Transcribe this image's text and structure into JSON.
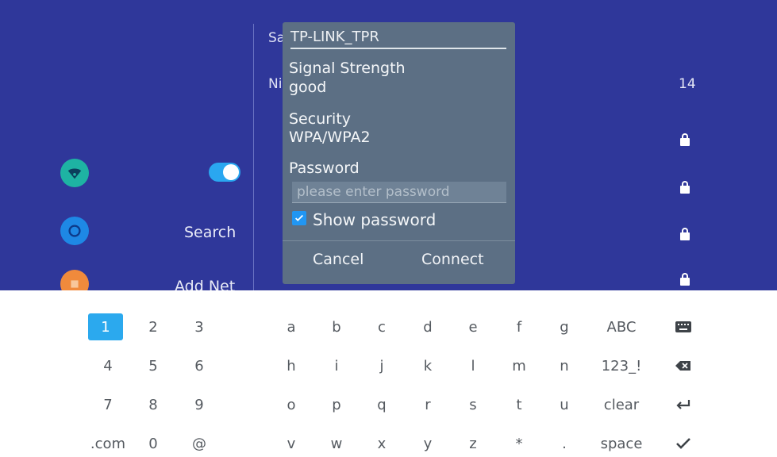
{
  "sidebar": {
    "search_label": "Search",
    "addnet_label": "Add Net"
  },
  "background": {
    "partial_row_1": "Sa",
    "partial_row_2": "Ni",
    "network_count": "14"
  },
  "dialog": {
    "ssid": "TP-LINK_TPR",
    "signal_label": "Signal Strength",
    "signal_value": "good",
    "security_label": "Security",
    "security_value": "WPA/WPA2",
    "password_label": "Password",
    "password_placeholder": "please enter password",
    "show_password_label": "Show password",
    "show_password_checked": true,
    "cancel_label": "Cancel",
    "connect_label": "Connect"
  },
  "keyboard": {
    "rows": [
      [
        "1",
        "2",
        "3",
        "a",
        "b",
        "c",
        "d",
        "e",
        "f",
        "g",
        "ABC"
      ],
      [
        "4",
        "5",
        "6",
        "h",
        "i",
        "j",
        "k",
        "l",
        "m",
        "n",
        "123_!"
      ],
      [
        "7",
        "8",
        "9",
        "o",
        "p",
        "q",
        "r",
        "s",
        "t",
        "u",
        "clear"
      ],
      [
        ".com",
        "0",
        "@",
        "v",
        "w",
        "x",
        "y",
        "z",
        "*",
        ".",
        "space"
      ]
    ],
    "action_icons": [
      "keyboard-icon",
      "backspace-icon",
      "enter-icon",
      "checkmark-icon"
    ],
    "selected_key": "1"
  },
  "colors": {
    "screen_bg": "#2f379a",
    "dialog_bg": "#5c6f84",
    "accent": "#2ba9ee",
    "wifi_icon": "#1eb3a3",
    "search_icon": "#1e88e5",
    "add_icon": "#f08a3c"
  }
}
